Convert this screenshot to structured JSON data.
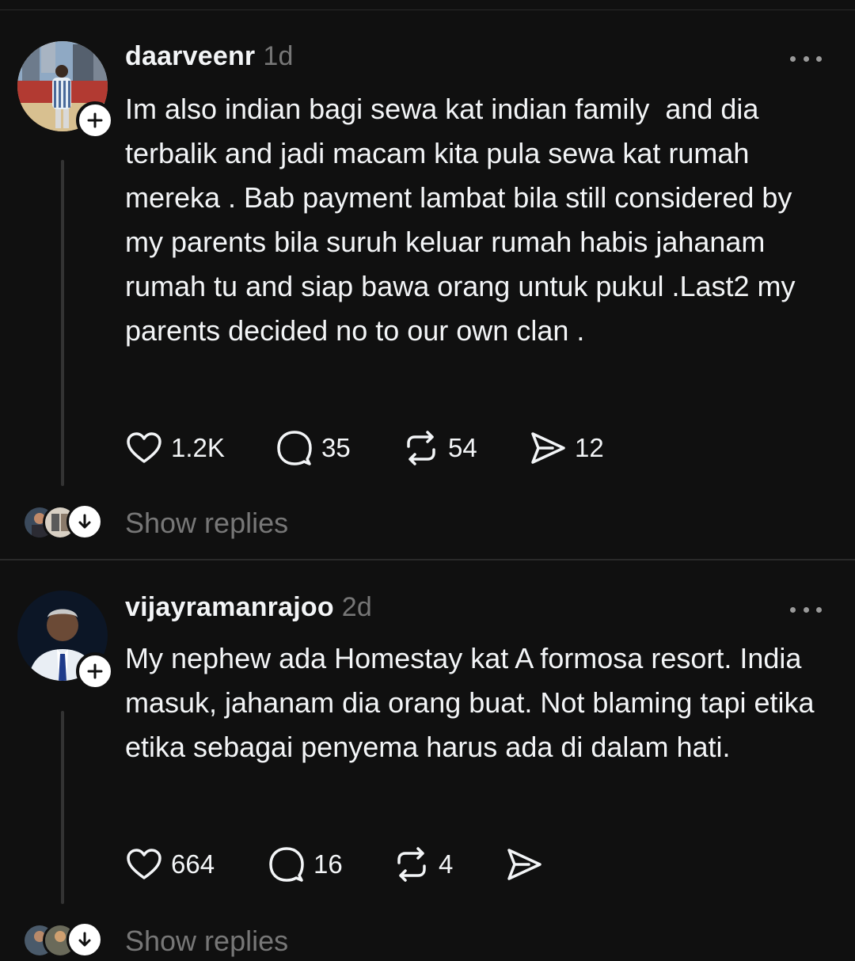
{
  "posts": [
    {
      "username": "daarveenr",
      "time": "1d",
      "text": "Im also indian bagi sewa kat indian family  and dia terbalik and jadi macam kita pula sewa kat rumah mereka . Bab payment lambat bila still considered by my parents bila suruh keluar rumah habis jahanam rumah tu and siap bawa orang untuk pukul .Last2 my parents decided no to our own clan .",
      "likes": "1.2K",
      "comments": "35",
      "reposts": "54",
      "shares": "12",
      "show_replies": "Show replies"
    },
    {
      "username": "vijayramanrajoo",
      "time": "2d",
      "text": "My nephew ada Homestay kat A formosa resort. India masuk, jahanam dia orang buat. Not blaming tapi etika etika sebagai penyema harus ada di dalam hati.",
      "likes": "664",
      "comments": "16",
      "reposts": "4",
      "shares": "",
      "show_replies": "Show replies"
    }
  ],
  "icons": {
    "like": "heart-icon",
    "comment": "comment-bubble-icon",
    "repost": "repost-icon",
    "share": "send-icon",
    "more": "more-dots-icon",
    "follow": "plus-icon",
    "expand": "arrow-down-icon"
  },
  "colors": {
    "background": "#101010",
    "text": "#f3f5f7",
    "muted": "#777777",
    "divider": "#2a2a2a"
  }
}
